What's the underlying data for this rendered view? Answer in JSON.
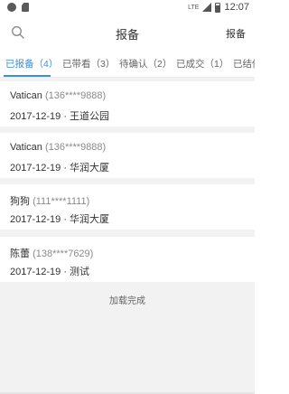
{
  "status_bar": {
    "network": "LTE",
    "time": "12:07",
    "icons": [
      "notification-dot-icon",
      "sim-card-icon",
      "signal-icon",
      "battery-icon"
    ]
  },
  "header": {
    "title": "报备",
    "action": "报备",
    "search_icon": "search-icon"
  },
  "tabs": [
    {
      "label": "已报备（4）",
      "active": true
    },
    {
      "label": "已带看（3）",
      "active": false
    },
    {
      "label": "待确认（2）",
      "active": false
    },
    {
      "label": "已成交（1）",
      "active": false
    },
    {
      "label": "已结佣",
      "active": false
    }
  ],
  "items": [
    {
      "name": "Vatican",
      "phone": "(136****9888)",
      "info": "2017-12-19 · 王道公园"
    },
    {
      "name": "Vatican",
      "phone": "(136****9888)",
      "info": "2017-12-19 · 华润大厦"
    },
    {
      "name": "狗狗",
      "phone": "(111****1111)",
      "info": "2017-12-19 · 华润大厦"
    },
    {
      "name": "陈蕾",
      "phone": "(138****7629)",
      "info": "2017-12-19 · 测试"
    }
  ],
  "footer": {
    "loaded_text": "加载完成"
  },
  "colors": {
    "accent": "#3c8fe0",
    "list_background": "#f2f2f2"
  }
}
